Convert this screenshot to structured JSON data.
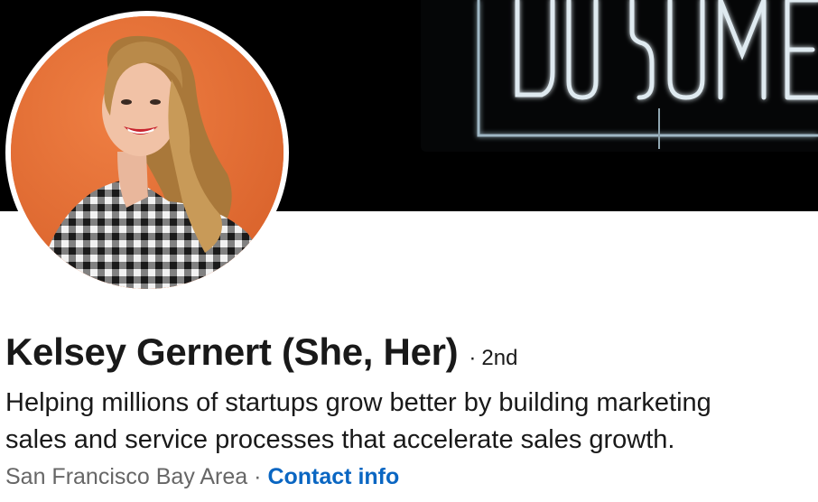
{
  "profile": {
    "name": "Kelsey Gernert (She, Her)",
    "degree_separator": "·",
    "degree": "2nd",
    "headline_line1": "Helping millions of startups grow better by building marketing",
    "headline_line2": "sales and service processes that accelerate sales growth.",
    "location": "San Francisco Bay Area",
    "meta_separator": "·",
    "contact_label": "Contact info"
  },
  "colors": {
    "link": "#0a66c2",
    "text_primary": "#191919",
    "text_secondary": "#666666",
    "avatar_background": "#e8733b",
    "banner_background": "#000000"
  },
  "icons": {
    "banner_image": "neon-sign-image",
    "avatar_image": "profile-photo-image"
  }
}
